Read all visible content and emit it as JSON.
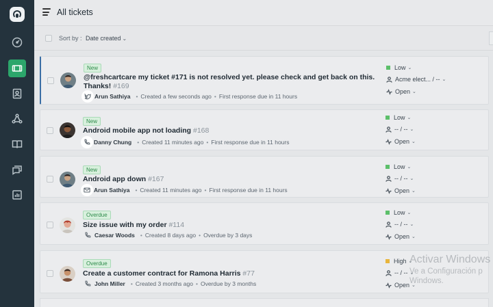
{
  "header": {
    "title": "All tickets"
  },
  "toolbar": {
    "sort_label": "Sort by :",
    "sort_value": "Date created"
  },
  "sidebar": {
    "items": [
      {
        "name": "dashboard-icon"
      },
      {
        "name": "tickets-icon",
        "active": true
      },
      {
        "name": "contacts-icon"
      },
      {
        "name": "social-icon"
      },
      {
        "name": "knowledge-base-icon"
      },
      {
        "name": "forums-icon"
      },
      {
        "name": "reports-icon"
      }
    ]
  },
  "tickets": [
    {
      "badge": "New",
      "subject": "@freshcartcare my ticket #171 is not resolved yet. please check and get back on this. Thanks!",
      "id": "#169",
      "source_icon": "twitter-icon",
      "requester": "Arun Sathiya",
      "meta1": "Created a few seconds ago",
      "meta2": "First response due in 11 hours",
      "priority": "Low",
      "assignee": "Acme elect... / --",
      "status": "Open"
    },
    {
      "badge": "New",
      "subject": "Android mobile app not loading",
      "id": "#168",
      "source_icon": "phone-icon",
      "requester": "Danny Chung",
      "meta1": "Created 11 minutes ago",
      "meta2": "First response due in 11 hours",
      "priority": "Low",
      "assignee": "-- / --",
      "status": "Open"
    },
    {
      "badge": "New",
      "subject": "Android app down",
      "id": "#167",
      "source_icon": "email-icon",
      "requester": "Arun Sathiya",
      "meta1": "Created 11 minutes ago",
      "meta2": "First response due in 11 hours",
      "priority": "Low",
      "assignee": "-- / --",
      "status": "Open"
    },
    {
      "badge": "Overdue",
      "subject": "Size issue with my order",
      "id": "#114",
      "source_icon": "phone-icon",
      "requester": "Caesar Woods",
      "meta1": "Created 8 days ago",
      "meta2": "Overdue by 3 days",
      "priority": "Low",
      "assignee": "-- / --",
      "status": "Open"
    },
    {
      "badge": "Overdue",
      "subject": "Create a customer contract for Ramona Harris",
      "id": "#77",
      "source_icon": "phone-icon",
      "requester": "John Miller",
      "meta1": "Created 3 months ago",
      "meta2": "Overdue by 3 months",
      "priority": "High",
      "assignee": "-- / --",
      "status": "Open"
    }
  ],
  "watermark": {
    "title": "Activar Windows",
    "line1": "Ve a Configuración p",
    "line2": "Windows."
  },
  "colors": {
    "accent": "#2ca66b",
    "sidebar": "#24333d",
    "low": "#5cbf6a",
    "high": "#e8b53c"
  }
}
